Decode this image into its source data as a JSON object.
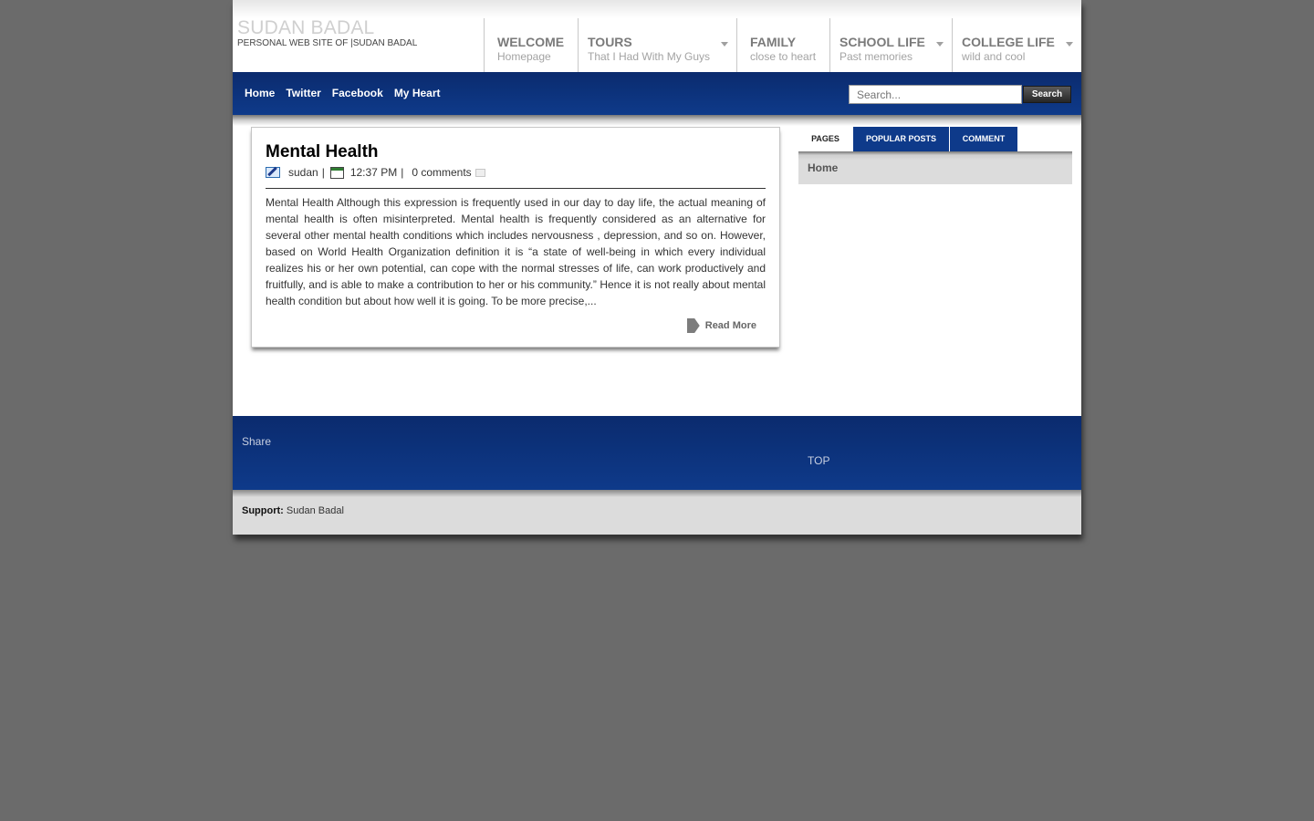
{
  "site": {
    "title": "SUDAN BADAL",
    "description": "PERSONAL WEB SITE OF |SUDAN BADAL"
  },
  "main_menu": [
    {
      "title": "WELCOME",
      "subtitle": "Homepage"
    },
    {
      "title": "TOURS",
      "subtitle": "That I Had With My Guys"
    },
    {
      "title": "FAMILY",
      "subtitle": "close to heart"
    },
    {
      "title": "SCHOOL LIFE",
      "subtitle": "Past memories"
    },
    {
      "title": "COLLEGE LIFE",
      "subtitle": "wild and cool"
    }
  ],
  "nav": {
    "links": [
      "Home",
      "Twitter",
      "Facebook",
      "My Heart"
    ],
    "search_placeholder": "Search...",
    "search_button": "Search"
  },
  "post": {
    "title": "Mental Health",
    "author": "sudan",
    "time": "12:37 PM",
    "comments": "0 comments",
    "excerpt": "Mental Health Although this expression is frequently used in our day to day life, the actual meaning of mental health is often misinterpreted. Mental health is frequently considered as an alternative for several other mental health conditions which includes nervousness , depression, and so on. However, based on World Health Organization definition it is “a state of well-being in which every individual realizes his or her own potential, can cope with the normal stresses of life, can work productively and fruitfully, and is able to make a contribution to her or his community.” Hence it is not really about mental health condition but about how well it is going. To be more precise,...",
    "read_more": "Read More"
  },
  "sidebar": {
    "tabs": [
      "PAGES",
      "POPULAR POSTS",
      "COMMENT"
    ],
    "pages": [
      "Home"
    ]
  },
  "footer": {
    "share": "Share",
    "top": "TOP",
    "support_label": "Support:",
    "support_name": "Sudan Badal"
  },
  "colors": {
    "brand_blue": "#0e3a8a",
    "background": "#6b6b6b"
  }
}
